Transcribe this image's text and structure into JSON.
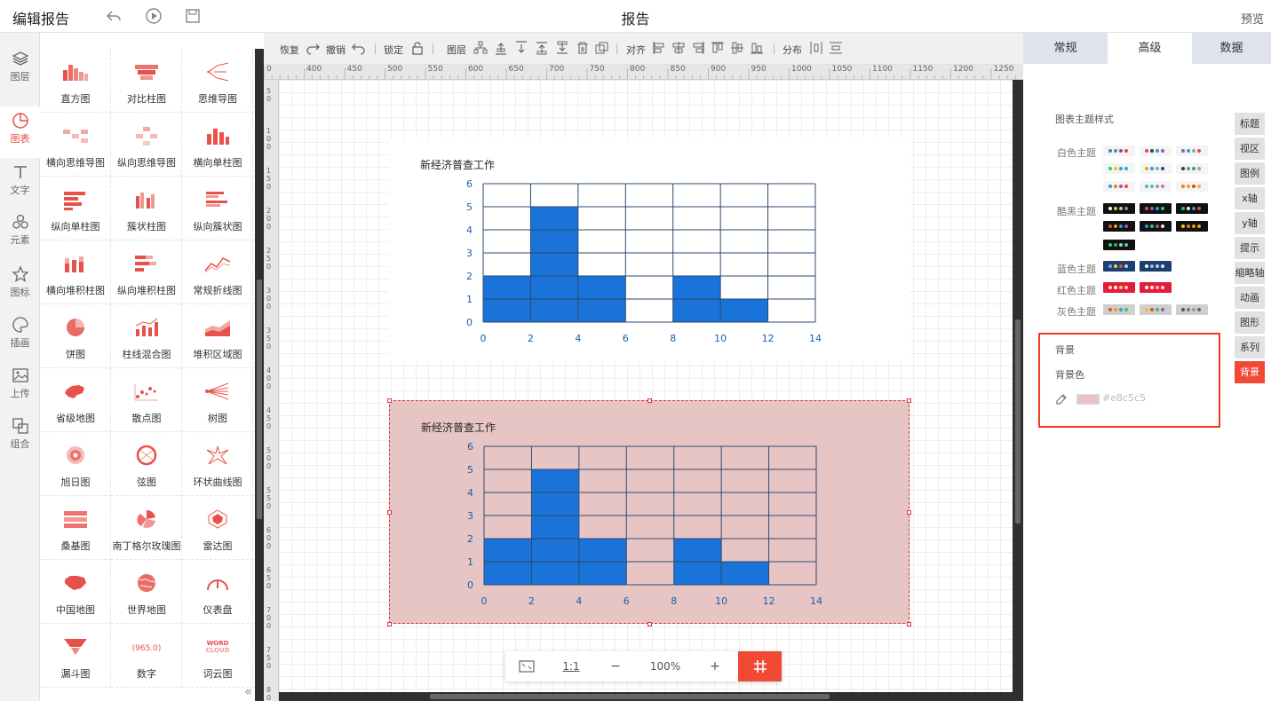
{
  "header": {
    "title": "编辑报告",
    "center_title": "报告",
    "preview": "预览"
  },
  "leftnav": [
    "图层",
    "图表",
    "文字",
    "元素",
    "图标",
    "插画",
    "上传",
    "组合"
  ],
  "components": [
    "直方图",
    "对比柱图",
    "思维导图",
    "横向思维导图",
    "纵向思维导图",
    "横向单柱图",
    "纵向单柱图",
    "簇状柱图",
    "纵向簇状图",
    "横向堆积柱图",
    "纵向堆积柱图",
    "常规折线图",
    "饼图",
    "柱线混合图",
    "堆积区域图",
    "省级地图",
    "散点图",
    "树图",
    "旭日图",
    "弦图",
    "环状曲线图",
    "桑基图",
    "南丁格尔玫瑰图",
    "雷达图",
    "中国地图",
    "世界地图",
    "仪表盘",
    "漏斗图",
    "数字",
    "词云图"
  ],
  "toolbar": {
    "redo": "恢复",
    "undo": "撤销",
    "lock": "锁定",
    "layer": "图层",
    "align": "对齐",
    "distribute": "分布"
  },
  "ruler_h": [
    "0",
    "400",
    "450",
    "500",
    "550",
    "600",
    "650",
    "700",
    "750",
    "800",
    "850",
    "900",
    "950",
    "1000",
    "1050",
    "1100",
    "1150",
    "1200",
    "1250"
  ],
  "ruler_v": [
    "50",
    "100",
    "150",
    "200",
    "250",
    "300",
    "350",
    "400",
    "450",
    "500",
    "550",
    "600",
    "650",
    "700",
    "750",
    "800"
  ],
  "zoom": {
    "ratio": "1:1",
    "minus": "−",
    "level": "100%",
    "plus": "+"
  },
  "right_tabs": [
    "常规",
    "高级",
    "数据"
  ],
  "theme_section": "图表主题样式",
  "theme_labels": [
    "白色主题",
    "酷黑主题",
    "蓝色主题",
    "红色主题",
    "灰色主题"
  ],
  "bg_section": "背景",
  "bg_color_label": "背景色",
  "bg_color_value": "#e8c5c5",
  "side_tabs": [
    "标题",
    "视区",
    "图例",
    "x轴",
    "y轴",
    "提示",
    "缩略轴",
    "动画",
    "图形",
    "系列",
    "背景"
  ],
  "chart_data": [
    {
      "type": "bar",
      "title": "新经济普查工作",
      "x": [
        0,
        2,
        4,
        6,
        8,
        10,
        12,
        14
      ],
      "bins": [
        [
          0,
          2,
          2
        ],
        [
          2,
          4,
          5
        ],
        [
          4,
          6,
          2
        ],
        [
          6,
          8,
          0
        ],
        [
          8,
          10,
          2
        ],
        [
          10,
          12,
          1
        ],
        [
          12,
          14,
          0
        ]
      ],
      "xlim": [
        0,
        14
      ],
      "ylim": [
        0,
        6
      ],
      "xticks": [
        "0",
        "2",
        "4",
        "6",
        "8",
        "10",
        "12",
        "14"
      ],
      "yticks": [
        "0",
        "1",
        "2",
        "3",
        "4",
        "5",
        "6"
      ],
      "bar_color": "#1a73d8",
      "background": "#ffffff",
      "grid": true
    },
    {
      "type": "bar",
      "title": "新经济普查工作",
      "x": [
        0,
        2,
        4,
        6,
        8,
        10,
        12,
        14
      ],
      "bins": [
        [
          0,
          2,
          2
        ],
        [
          2,
          4,
          5
        ],
        [
          4,
          6,
          2
        ],
        [
          6,
          8,
          0
        ],
        [
          8,
          10,
          2
        ],
        [
          10,
          12,
          1
        ],
        [
          12,
          14,
          0
        ]
      ],
      "xlim": [
        0,
        14
      ],
      "ylim": [
        0,
        6
      ],
      "xticks": [
        "0",
        "2",
        "4",
        "6",
        "8",
        "10",
        "12",
        "14"
      ],
      "yticks": [
        "0",
        "1",
        "2",
        "3",
        "4",
        "5",
        "6"
      ],
      "bar_color": "#1a73d8",
      "background": "#e8c5c5",
      "grid": true
    }
  ]
}
